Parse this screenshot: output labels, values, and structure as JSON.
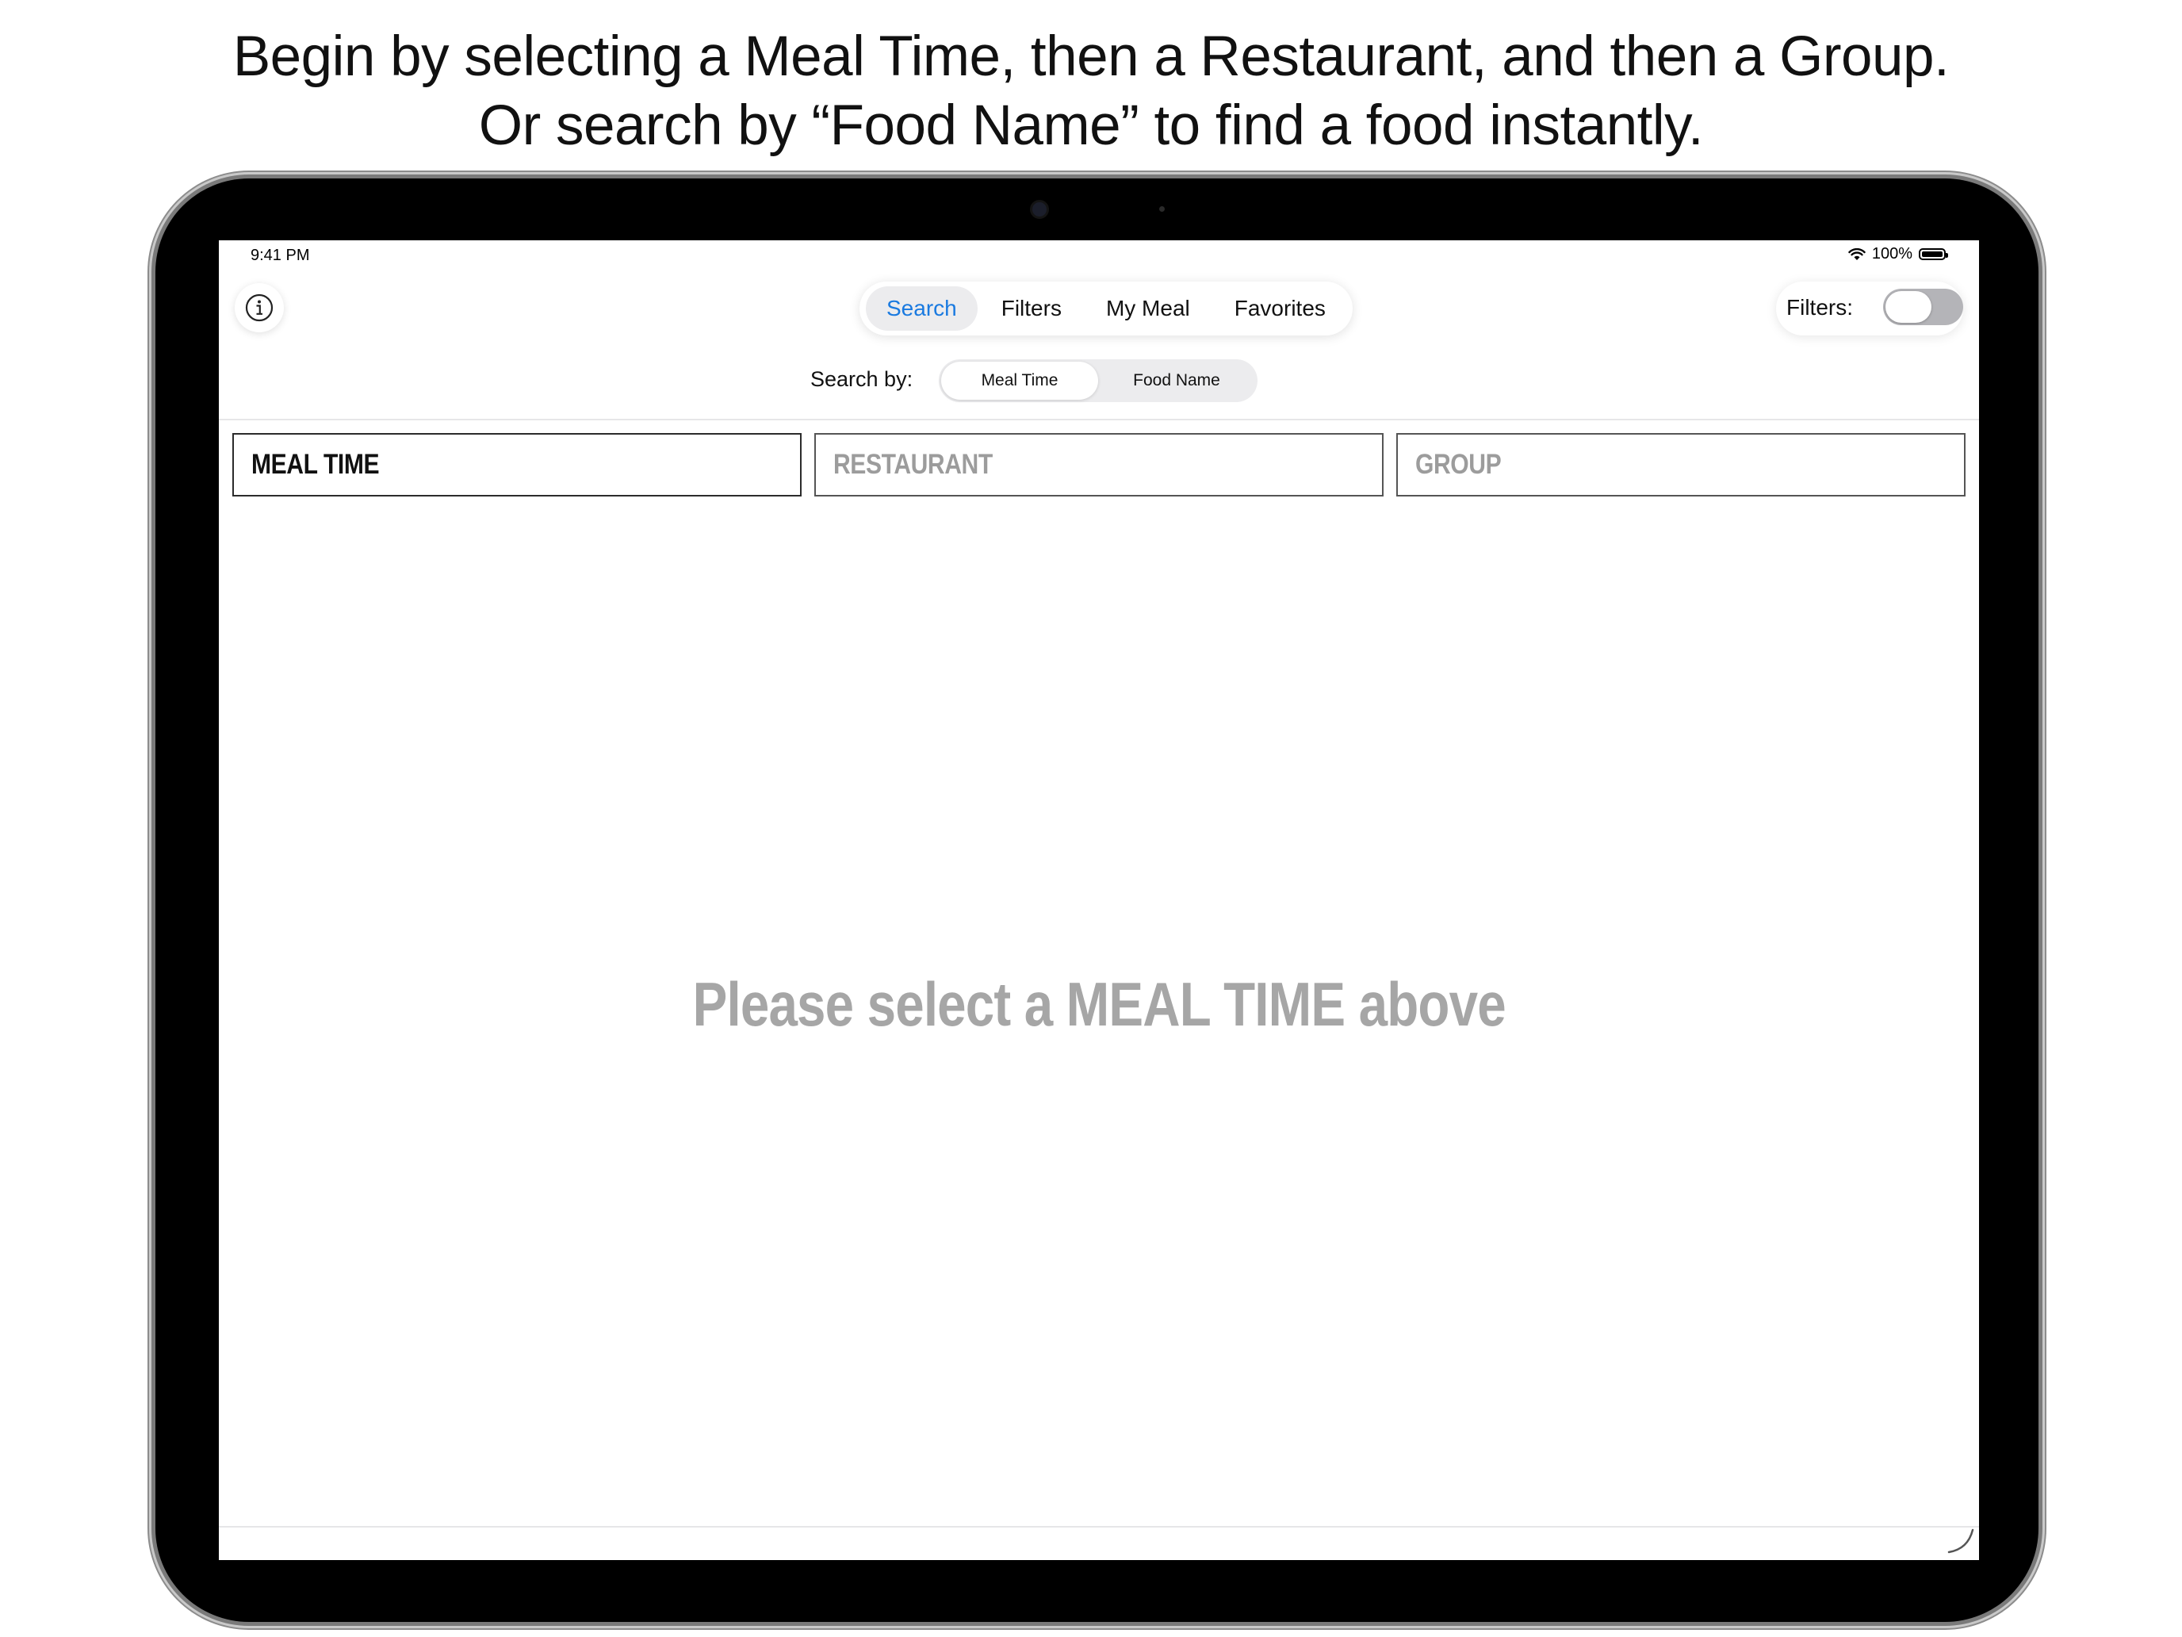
{
  "caption": {
    "line1": "Begin by selecting a Meal Time, then a Restaurant, and then a Group.",
    "line2": "Or search by “Food Name” to find a food instantly."
  },
  "status_bar": {
    "time": "9:41 PM",
    "battery_percent": "100%",
    "battery_level": 1.0,
    "wifi_icon": "wifi-icon",
    "battery_icon": "battery-icon"
  },
  "toolbar": {
    "info_icon": "info-icon",
    "tabs": [
      {
        "label": "Search",
        "active": true
      },
      {
        "label": "Filters",
        "active": false
      },
      {
        "label": "My Meal",
        "active": false
      },
      {
        "label": "Favorites",
        "active": false
      }
    ],
    "filters_label": "Filters:",
    "filters_toggle_on": false
  },
  "search_by": {
    "label": "Search by:",
    "options": [
      {
        "label": "Meal Time",
        "selected": true
      },
      {
        "label": "Food Name",
        "selected": false
      }
    ]
  },
  "selectors": [
    {
      "label": "MEAL TIME",
      "enabled": true
    },
    {
      "label": "RESTAURANT",
      "enabled": false
    },
    {
      "label": "GROUP",
      "enabled": false
    }
  ],
  "empty_state": {
    "message": "Please select a MEAL TIME above"
  },
  "colors": {
    "accent": "#1a7ae0",
    "disabled_text": "#9c9c9c",
    "empty_text": "#a6a6a6",
    "toggle_off": "#b4b4b8",
    "segment_bg": "#ececee"
  }
}
